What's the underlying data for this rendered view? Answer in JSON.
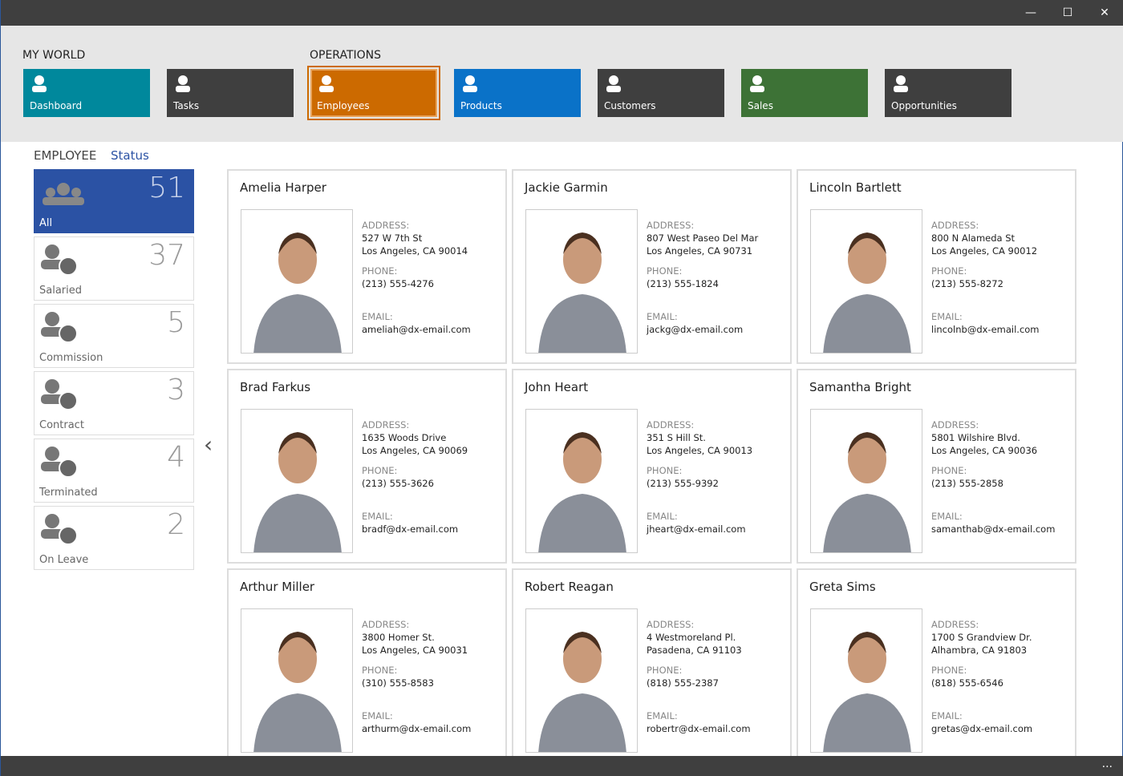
{
  "window": {
    "minimize": "—",
    "maximize": "☐",
    "close": "✕"
  },
  "groups": {
    "my_world": "MY WORLD",
    "operations": "OPERATIONS"
  },
  "tiles": [
    {
      "label": "Dashboard",
      "color": "#00889c",
      "icon": "dashboard-icon"
    },
    {
      "label": "Tasks",
      "color": "#3f3f3f",
      "icon": "calendar-check-icon"
    },
    {
      "label": "Employees",
      "color": "#cc6a00",
      "icon": "person-icon"
    },
    {
      "label": "Products",
      "color": "#0a72c8",
      "icon": "box-icon"
    },
    {
      "label": "Customers",
      "color": "#3f3f3f",
      "icon": "customer-tie-icon"
    },
    {
      "label": "Sales",
      "color": "#3d7236",
      "icon": "cart-icon"
    },
    {
      "label": "Opportunities",
      "color": "#3f3f3f",
      "icon": "chart-icon"
    }
  ],
  "breadcrumb": {
    "root": "EMPLOYEE",
    "current": "Status"
  },
  "statuses": [
    {
      "label": "All",
      "count": "51"
    },
    {
      "label": "Salaried",
      "count": "37"
    },
    {
      "label": "Commission",
      "count": "5"
    },
    {
      "label": "Contract",
      "count": "3"
    },
    {
      "label": "Terminated",
      "count": "4"
    },
    {
      "label": "On Leave",
      "count": "2"
    }
  ],
  "labels": {
    "address": "ADDRESS:",
    "phone": "PHONE:",
    "email": "EMAIL:",
    "back": "‹",
    "more": "..."
  },
  "employees": [
    {
      "name": "Amelia Harper",
      "addr1": "527 W 7th St",
      "addr2": "Los Angeles, CA 90014",
      "phone": "(213) 555-4276",
      "email": "ameliah@dx-email.com"
    },
    {
      "name": "Jackie Garmin",
      "addr1": "807 West Paseo Del Mar",
      "addr2": "Los Angeles, CA 90731",
      "phone": "(213) 555-1824",
      "email": "jackg@dx-email.com"
    },
    {
      "name": "Lincoln Bartlett",
      "addr1": "800 N Alameda St",
      "addr2": "Los Angeles, CA 90012",
      "phone": "(213) 555-8272",
      "email": "lincolnb@dx-email.com"
    },
    {
      "name": "Brad Farkus",
      "addr1": "1635 Woods Drive",
      "addr2": "Los Angeles, CA 90069",
      "phone": "(213) 555-3626",
      "email": "bradf@dx-email.com"
    },
    {
      "name": "John Heart",
      "addr1": "351 S Hill St.",
      "addr2": "Los Angeles, CA 90013",
      "phone": "(213) 555-9392",
      "email": "jheart@dx-email.com"
    },
    {
      "name": "Samantha Bright",
      "addr1": "5801 Wilshire Blvd.",
      "addr2": "Los Angeles, CA 90036",
      "phone": "(213) 555-2858",
      "email": "samanthab@dx-email.com"
    },
    {
      "name": "Arthur Miller",
      "addr1": "3800 Homer St.",
      "addr2": "Los Angeles, CA 90031",
      "phone": "(310) 555-8583",
      "email": "arthurm@dx-email.com"
    },
    {
      "name": "Robert Reagan",
      "addr1": "4 Westmoreland Pl.",
      "addr2": "Pasadena, CA 91103",
      "phone": "(818) 555-2387",
      "email": "robertr@dx-email.com"
    },
    {
      "name": "Greta Sims",
      "addr1": "1700 S Grandview Dr.",
      "addr2": "Alhambra, CA 91803",
      "phone": "(818) 555-6546",
      "email": "gretas@dx-email.com"
    }
  ]
}
